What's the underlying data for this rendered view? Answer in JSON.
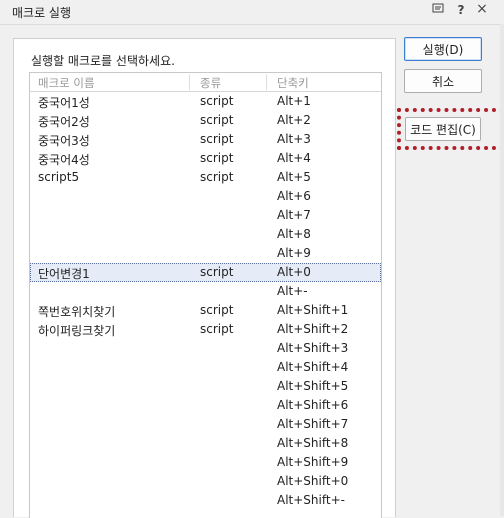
{
  "window": {
    "title": "매크로 실행",
    "icons": {
      "comment": "comment-icon",
      "help": "?",
      "close": "×"
    }
  },
  "prompt": "실행할 매크로를 선택하세요.",
  "columns": [
    "매크로 이름",
    "종류",
    "단축키"
  ],
  "rows": [
    {
      "name": "중국어1성",
      "type": "script",
      "key": "Alt+1"
    },
    {
      "name": "중국어2성",
      "type": "script",
      "key": "Alt+2"
    },
    {
      "name": "중국어3성",
      "type": "script",
      "key": "Alt+3"
    },
    {
      "name": "중국어4성",
      "type": "script",
      "key": "Alt+4"
    },
    {
      "name": "script5",
      "type": "script",
      "key": "Alt+5"
    },
    {
      "name": "",
      "type": "",
      "key": "Alt+6"
    },
    {
      "name": "",
      "type": "",
      "key": "Alt+7"
    },
    {
      "name": "",
      "type": "",
      "key": "Alt+8"
    },
    {
      "name": "",
      "type": "",
      "key": "Alt+9"
    },
    {
      "name": "단어변경1",
      "type": "script",
      "key": "Alt+0",
      "selected": true
    },
    {
      "name": "",
      "type": "",
      "key": "Alt+-"
    },
    {
      "name": "쪽번호위치찾기",
      "type": "script",
      "key": "Alt+Shift+1"
    },
    {
      "name": "하이퍼링크찾기",
      "type": "script",
      "key": "Alt+Shift+2"
    },
    {
      "name": "",
      "type": "",
      "key": "Alt+Shift+3"
    },
    {
      "name": "",
      "type": "",
      "key": "Alt+Shift+4"
    },
    {
      "name": "",
      "type": "",
      "key": "Alt+Shift+5"
    },
    {
      "name": "",
      "type": "",
      "key": "Alt+Shift+6"
    },
    {
      "name": "",
      "type": "",
      "key": "Alt+Shift+7"
    },
    {
      "name": "",
      "type": "",
      "key": "Alt+Shift+8"
    },
    {
      "name": "",
      "type": "",
      "key": "Alt+Shift+9"
    },
    {
      "name": "",
      "type": "",
      "key": "Alt+Shift+0"
    },
    {
      "name": "",
      "type": "",
      "key": "Alt+Shift+-"
    }
  ],
  "buttons": {
    "run": "실행(D)",
    "cancel": "취소",
    "edit": "코드 편집(C)"
  },
  "colors": {
    "primary_border": "#3c7fd1",
    "selection_bg": "#e6ecf7",
    "annotation": "#b0202a"
  }
}
